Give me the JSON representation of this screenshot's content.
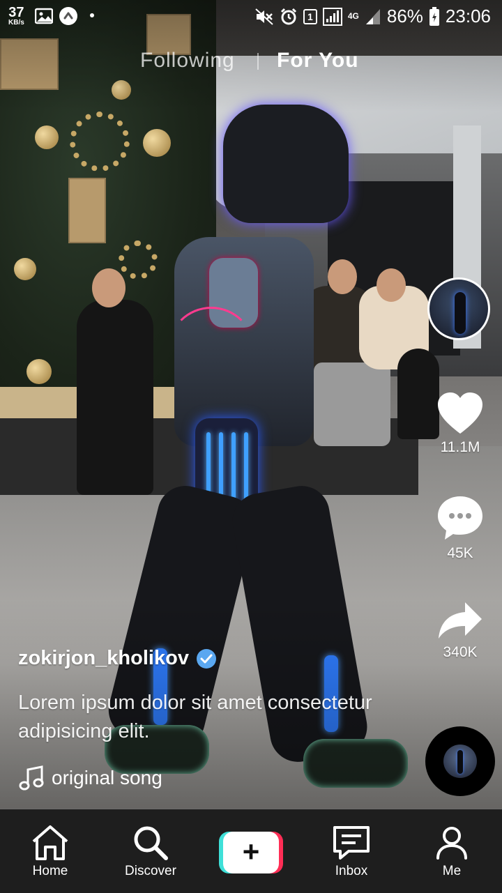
{
  "status_bar": {
    "net_speed_value": "37",
    "net_speed_unit": "KB/s",
    "sim_slot": "1",
    "network_type": "4G",
    "battery_percent": "86%",
    "time": "23:06",
    "icons": [
      "gallery-icon",
      "app-notification-icon",
      "mute-icon",
      "alarm-icon",
      "signal-icon",
      "battery-icon"
    ]
  },
  "feed_tabs": {
    "following": "Following",
    "for_you": "For You",
    "active": "For You"
  },
  "actions": {
    "likes": "11.1M",
    "comments": "45K",
    "shares": "340K"
  },
  "post": {
    "username": "zokirjon_kholikov",
    "verified": true,
    "description": "Lorem ipsum dolor sit amet consectetur adipisicing elit.",
    "sound": "original song"
  },
  "bottom_nav": {
    "home": "Home",
    "discover": "Discover",
    "create": "+",
    "inbox": "Inbox",
    "me": "Me",
    "active": "Home"
  },
  "colors": {
    "create_left": "#3fe0d8",
    "create_right": "#ff2d55",
    "verified_badge": "#5aa7f0"
  }
}
